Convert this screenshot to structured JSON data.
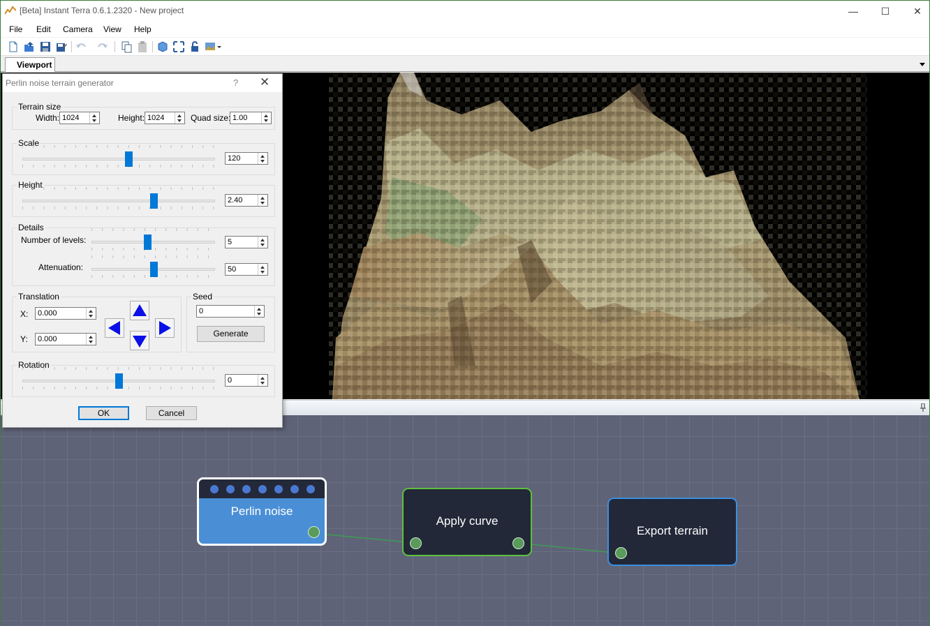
{
  "window": {
    "title": "[Beta] Instant Terra 0.6.1.2320 - New project",
    "minimize_glyph": "—",
    "maximize_glyph": "☐",
    "close_glyph": "✕"
  },
  "menu": [
    "File",
    "Edit",
    "Camera",
    "View",
    "Help"
  ],
  "toolbar": {
    "icons": [
      "new-file-icon",
      "open-icon",
      "save-icon",
      "save-as-icon",
      "undo-icon",
      "redo-icon",
      "copy-icon",
      "paste-icon",
      "3d-view-icon",
      "fit-view-icon",
      "lock-icon",
      "texture-dropdown-icon"
    ]
  },
  "tabs": {
    "active": "Viewport"
  },
  "dialog": {
    "title": "Perlin noise terrain generator",
    "help_glyph": "?",
    "close_glyph": "✕",
    "terrain_size": {
      "label": "Terrain size",
      "width_label": "Width:",
      "width_value": "1024",
      "height_label": "Height:",
      "height_value": "1024",
      "quad_label": "Quad size:",
      "quad_value": "1.00"
    },
    "scale": {
      "label": "Scale",
      "value": "120",
      "slider_fraction": 0.55
    },
    "height": {
      "label": "Height",
      "value": "2.40",
      "slider_fraction": 0.68
    },
    "details": {
      "label": "Details",
      "levels_label": "Number of levels:",
      "levels_value": "5",
      "levels_fraction": 0.45,
      "attenuation_label": "Attenuation:",
      "attenuation_value": "50",
      "attenuation_fraction": 0.5
    },
    "translation": {
      "label": "Translation",
      "x_label": "X:",
      "x_value": "0.000",
      "y_label": "Y:",
      "y_value": "0.000"
    },
    "seed": {
      "label": "Seed",
      "value": "0",
      "generate_label": "Generate"
    },
    "rotation": {
      "label": "Rotation",
      "value": "0",
      "slider_fraction": 0.5
    },
    "ok_label": "OK",
    "cancel_label": "Cancel"
  },
  "graph": {
    "nodes": [
      {
        "title": "Perlin noise",
        "color": "#4a8fd6"
      },
      {
        "title": "Apply curve",
        "color": "#60c040"
      },
      {
        "title": "Export terrain",
        "color": "#3b8fe0"
      }
    ],
    "link_color": "#3f9a55"
  }
}
